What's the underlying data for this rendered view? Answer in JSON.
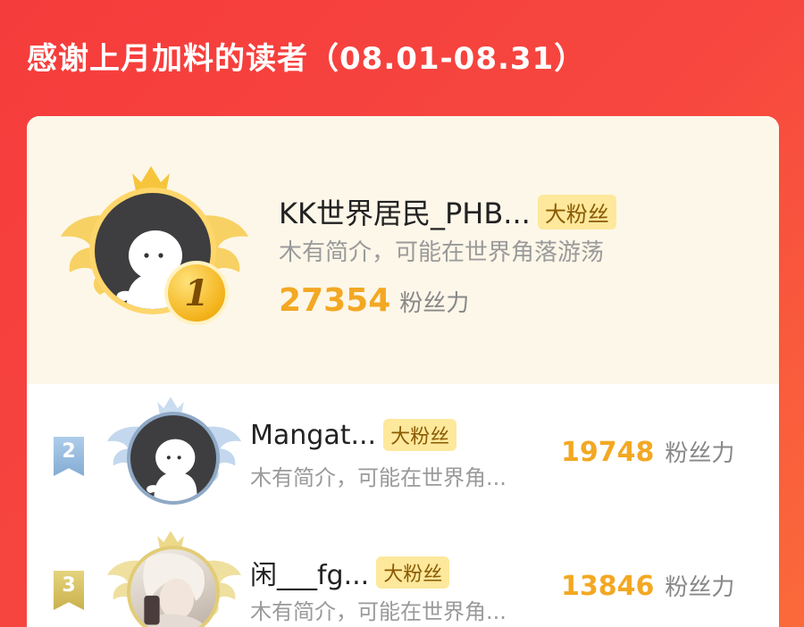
{
  "header": {
    "title": "感谢上月加料的读者（08.01-08.31）"
  },
  "top1": {
    "rank": "1",
    "name": "KK世界居民_PHB...",
    "tag": "大粉丝",
    "bio": "木有简介，可能在世界角落游荡",
    "score": "27354",
    "score_unit": "粉丝力"
  },
  "rows": [
    {
      "rank": "2",
      "name": "Mangat...",
      "tag": "大粉丝",
      "bio": "木有简介，可能在世界角...",
      "score": "19748",
      "score_unit": "粉丝力"
    },
    {
      "rank": "3",
      "name": "闲___fg...",
      "tag": "大粉丝",
      "bio": "木有简介，可能在世界角...",
      "score": "13846",
      "score_unit": "粉丝力"
    }
  ],
  "colors": {
    "background": "#f53c3c",
    "score": "#f3a823",
    "tag_bg": "#fde89c",
    "rank1_gold": "#f3b21a",
    "rank2_blue": "#84acd3",
    "rank3_gold": "#c9b14c"
  },
  "icons": [
    "crown-icon",
    "wing-icon",
    "default-avatar-icon",
    "rank-medal-icon",
    "rank-ribbon-icon"
  ]
}
